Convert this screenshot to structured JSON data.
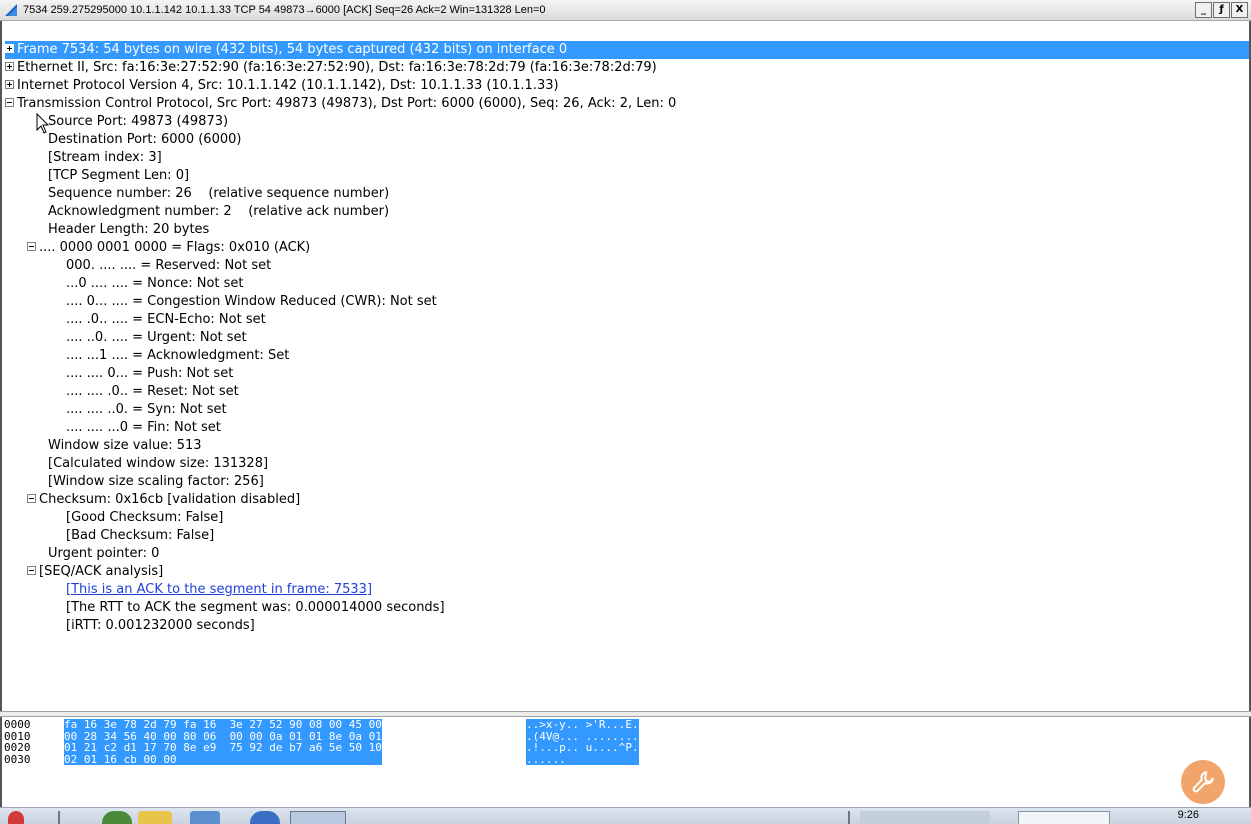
{
  "window": {
    "title": "7534 259.275295000 10.1.1.142 10.1.1.33 TCP 54 49873→6000 [ACK] Seq=26 Ack=2 Win=131328 Len=0",
    "controls": {
      "minimize": "_",
      "maximize": "ƒ",
      "close": "X"
    }
  },
  "tree": {
    "frame": "Frame 7534: 54 bytes on wire (432 bits), 54 bytes captured (432 bits) on interface 0",
    "ethernet": "Ethernet II, Src: fa:16:3e:27:52:90 (fa:16:3e:27:52:90), Dst: fa:16:3e:78:2d:79 (fa:16:3e:78:2d:79)",
    "ip": "Internet Protocol Version 4, Src: 10.1.1.142 (10.1.1.142), Dst: 10.1.1.33 (10.1.1.33)",
    "tcp": "Transmission Control Protocol, Src Port: 49873 (49873), Dst Port: 6000 (6000), Seq: 26, Ack: 2, Len: 0",
    "src_port": "Source Port: 49873 (49873)",
    "dst_port": "Destination Port: 6000 (6000)",
    "stream_index": "[Stream index: 3]",
    "segment_len": "[TCP Segment Len: 0]",
    "seq": "Sequence number: 26    (relative sequence number)",
    "ack": "Acknowledgment number: 2    (relative ack number)",
    "header_len": "Header Length: 20 bytes",
    "flags": ".... 0000 0001 0000 = Flags: 0x010 (ACK)",
    "flag_reserved": "000. .... .... = Reserved: Not set",
    "flag_nonce": "...0 .... .... = Nonce: Not set",
    "flag_cwr": ".... 0... .... = Congestion Window Reduced (CWR): Not set",
    "flag_ecn": ".... .0.. .... = ECN-Echo: Not set",
    "flag_urg": ".... ..0. .... = Urgent: Not set",
    "flag_ack": ".... ...1 .... = Acknowledgment: Set",
    "flag_push": ".... .... 0... = Push: Not set",
    "flag_reset": ".... .... .0.. = Reset: Not set",
    "flag_syn": ".... .... ..0. = Syn: Not set",
    "flag_fin": ".... .... ...0 = Fin: Not set",
    "window_value": "Window size value: 513",
    "calc_window": "[Calculated window size: 131328]",
    "scaling": "[Window size scaling factor: 256]",
    "checksum": "Checksum: 0x16cb [validation disabled]",
    "good_checksum": "[Good Checksum: False]",
    "bad_checksum": "[Bad Checksum: False]",
    "urgent_ptr": "Urgent pointer: 0",
    "seqack": "[SEQ/ACK analysis]",
    "ack_frame": "[This is an ACK to the segment in frame: 7533]",
    "rtt": "[The RTT to ACK the segment was: 0.000014000 seconds]",
    "irtt": "[iRTT: 0.001232000 seconds]"
  },
  "hex": {
    "offsets": "0000\n0010\n0020\n0030",
    "bytes": "fa 16 3e 78 2d 79 fa 16  3e 27 52 90 08 00 45 00\n00 28 34 56 40 00 80 06  00 00 0a 01 01 8e 0a 01\n01 21 c2 d1 17 70 8e e9  75 92 de b7 a6 5e 50 10\n02 01 16 cb 00 00",
    "ascii": "..>x-y.. >'R...E.\n.(4V@... ........\n.!...p.. u....^P.\n......"
  },
  "taskbar": {
    "clock": "9:26"
  },
  "colors": {
    "selection": "#3399ff",
    "link": "#2040d8"
  }
}
